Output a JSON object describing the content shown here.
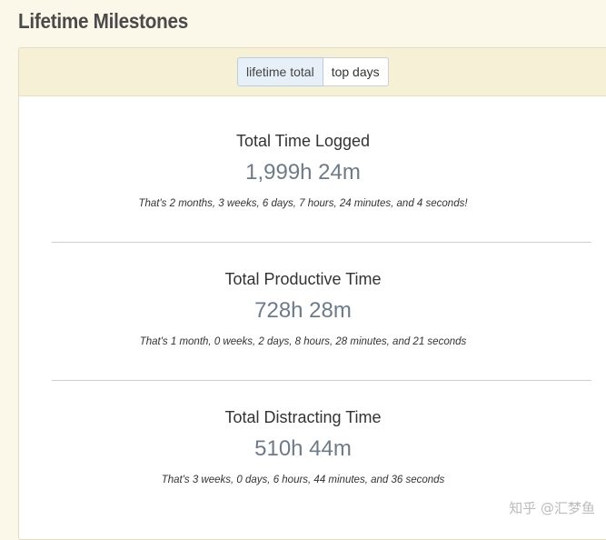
{
  "page": {
    "title": "Lifetime Milestones"
  },
  "tabs": [
    {
      "label": "lifetime total",
      "active": true
    },
    {
      "label": "top days",
      "active": false
    }
  ],
  "milestones": [
    {
      "label": "Total Time Logged",
      "value": "1,999h 24m",
      "detail": "That's 2 months, 3 weeks, 6 days, 7 hours, 24 minutes, and 4 seconds!"
    },
    {
      "label": "Total Productive Time",
      "value": "728h 28m",
      "detail": "That's 1 month, 0 weeks, 2 days, 8 hours, 28 minutes, and 21 seconds"
    },
    {
      "label": "Total Distracting Time",
      "value": "510h 44m",
      "detail": "That's 3 weeks, 0 days, 6 hours, 44 minutes, and 36 seconds"
    }
  ],
  "watermark": {
    "text": "知乎 @汇梦鱼"
  },
  "colors": {
    "page_background": "#fbf8ea",
    "panel_header": "#f6f0d6",
    "active_tab": "#e7f0f8",
    "value_text": "#6d7b88"
  }
}
